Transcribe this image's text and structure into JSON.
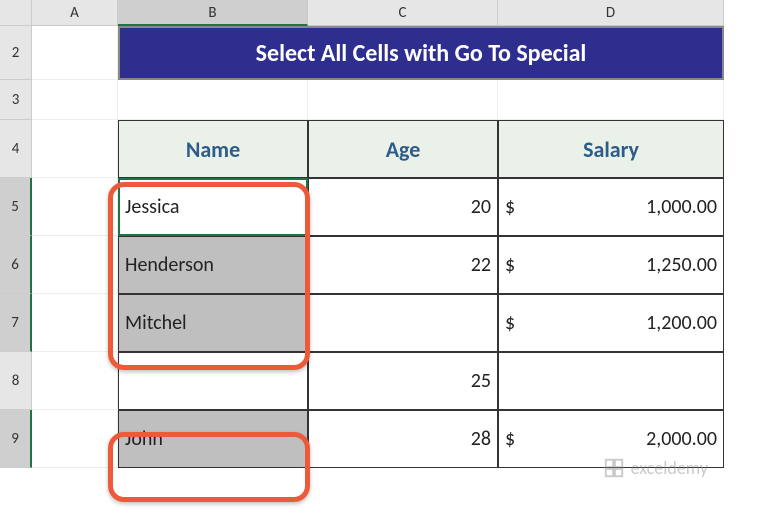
{
  "columns": {
    "a": "A",
    "b": "B",
    "c": "C",
    "d": "D"
  },
  "rows": {
    "r2": "2",
    "r3": "3",
    "r4": "4",
    "r5": "5",
    "r6": "6",
    "r7": "7",
    "r8": "8",
    "r9": "9"
  },
  "title": "Select All Cells with Go To Special",
  "headers": {
    "name": "Name",
    "age": "Age",
    "salary": "Salary"
  },
  "data": {
    "r5": {
      "name": "Jessica",
      "age": "20",
      "cur": "$",
      "salary": "1,000.00"
    },
    "r6": {
      "name": "Henderson",
      "age": "22",
      "cur": "$",
      "salary": "1,250.00"
    },
    "r7": {
      "name": "Mitchel",
      "age": "",
      "cur": "$",
      "salary": "1,200.00"
    },
    "r8": {
      "name": "",
      "age": "25",
      "cur": "",
      "salary": ""
    },
    "r9": {
      "name": "John",
      "age": "28",
      "cur": "$",
      "salary": "2,000.00"
    }
  },
  "watermark": "exceldemy"
}
